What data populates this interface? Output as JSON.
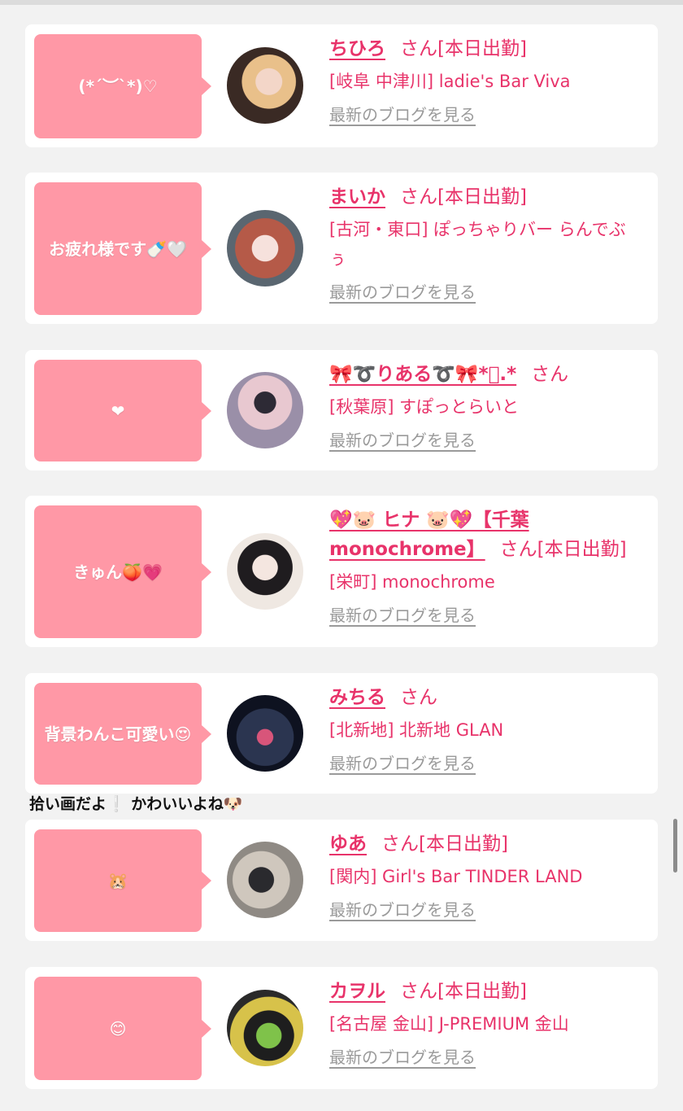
{
  "entries": [
    {
      "bubble": "(*´︶`*)♡",
      "name": "ちひろ",
      "san": "さん",
      "status": "[本日出勤]",
      "shop": "[岐阜 中津川] ladie's Bar Viva",
      "blog": "最新のブログを見る"
    },
    {
      "bubble": "お疲れ様です🍼🤍",
      "name": "まいか",
      "san": "さん",
      "status": "[本日出勤]",
      "shop": "[古河・東口] ぽっちゃりバー らんでぶぅ",
      "blog": "最新のブログを見る"
    },
    {
      "bubble": "❤",
      "name": "🎀➰りある➰🎀*ﾟ.*",
      "san": "さん",
      "status": "",
      "shop": "[秋葉原] すぽっとらいと",
      "blog": "最新のブログを見る"
    },
    {
      "bubble": "きゅん🍑💗",
      "name": "💖🐷 ヒナ 🐷💖【千葉monochrome】",
      "san": "さん",
      "status": "[本日出勤]",
      "shop": "[栄町] monochrome",
      "blog": "最新のブログを見る"
    },
    {
      "bubble": "背景わんこ可愛い😍",
      "name": "みちる",
      "san": "さん",
      "status": "",
      "shop": "[北新地] 北新地 GLAN",
      "blog": "最新のブログを見る"
    },
    {
      "bubble": "🐹",
      "name": "ゆあ",
      "san": "さん",
      "status": "[本日出勤]",
      "shop": "[関内] Girl's Bar TINDER LAND",
      "blog": "最新のブログを見る"
    },
    {
      "bubble": "😊",
      "name": "カヲル",
      "san": "さん",
      "status": "[本日出勤]",
      "shop": "[名古屋 金山] J-PREMIUM 金山",
      "blog": "最新のブログを見る"
    }
  ],
  "caption": "拾い画だよ❕ かわいいよね🐶",
  "colors": {
    "accent": "#e8336a",
    "bubble": "#ff98a6",
    "link_gray": "#9a9a9a",
    "background": "#f2f2f2"
  }
}
